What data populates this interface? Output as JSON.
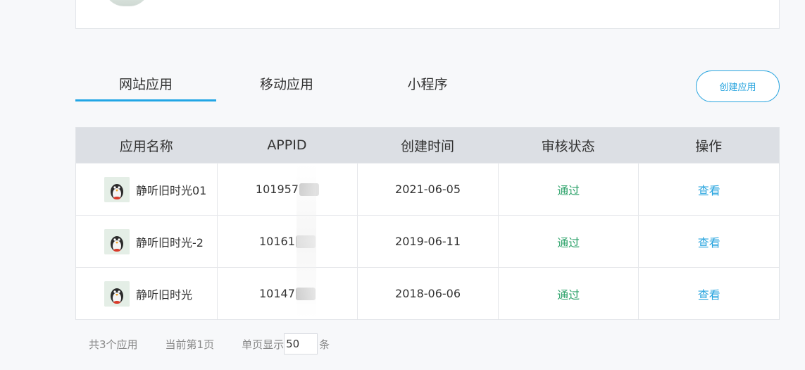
{
  "tabs": [
    {
      "label": "网站应用",
      "active": true
    },
    {
      "label": "移动应用",
      "active": false
    },
    {
      "label": "小程序",
      "active": false
    }
  ],
  "create_button": "创建应用",
  "table": {
    "headers": [
      "应用名称",
      "APPID",
      "创建时间",
      "审核状态",
      "操作"
    ],
    "rows": [
      {
        "name": "静听旧时光01",
        "appid": "101957",
        "created": "2021-06-05",
        "status": "通过",
        "action": "查看"
      },
      {
        "name": "静听旧时光-2",
        "appid": "10161",
        "created": "2019-06-11",
        "status": "通过",
        "action": "查看"
      },
      {
        "name": "静听旧时光",
        "appid": "10147",
        "created": "2018-06-06",
        "status": "通过",
        "action": "查看"
      }
    ]
  },
  "footer": {
    "total": "共3个应用",
    "current_page": "当前第1页",
    "per_page_prefix": "单页显示",
    "per_page_value": "50",
    "per_page_suffix": "条"
  },
  "colors": {
    "accent": "#2aa5df",
    "tab_underline": "#22a6e5",
    "status_pass": "#2ea36b",
    "header_bg": "#dcdfe4"
  },
  "icons": {
    "app_icon": "penguin-avatar-icon"
  }
}
